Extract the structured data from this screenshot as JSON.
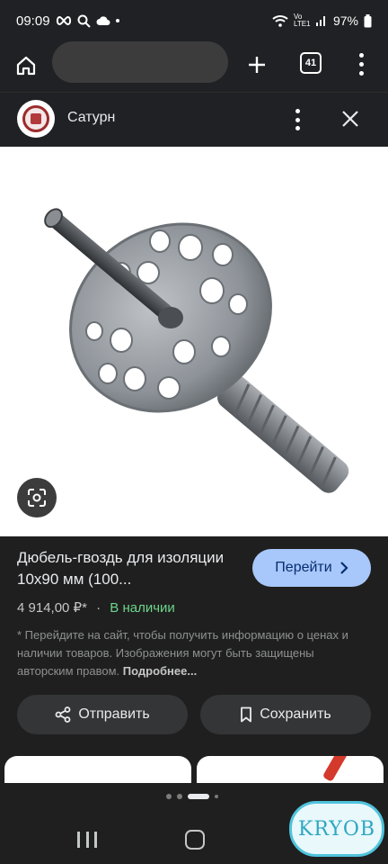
{
  "status": {
    "time": "09:09",
    "network": "Vo LTE1",
    "battery": "97%"
  },
  "toolbar": {
    "tab_count": "41"
  },
  "site": {
    "name": "Сатурн"
  },
  "product": {
    "title": "Дюбель-гвоздь для изоляции 10x90 мм (100...",
    "go_label": "Перейти",
    "price": "4 914,00 ₽*",
    "separator": "·",
    "stock": "В наличии",
    "note": "* Перейдите на сайт, чтобы получить информацию о ценах и наличии товаров. Изображения могут быть защищены авторским правом.",
    "more": "Подробнее..."
  },
  "actions": {
    "share": "Отправить",
    "save": "Сохранить"
  },
  "watermark": "KRYOB",
  "icons": [
    "home-icon",
    "plus-icon",
    "tabs-icon",
    "more-vert-icon",
    "close-icon",
    "google-lens-icon",
    "chevron-right-icon",
    "share-icon",
    "bookmark-icon"
  ]
}
